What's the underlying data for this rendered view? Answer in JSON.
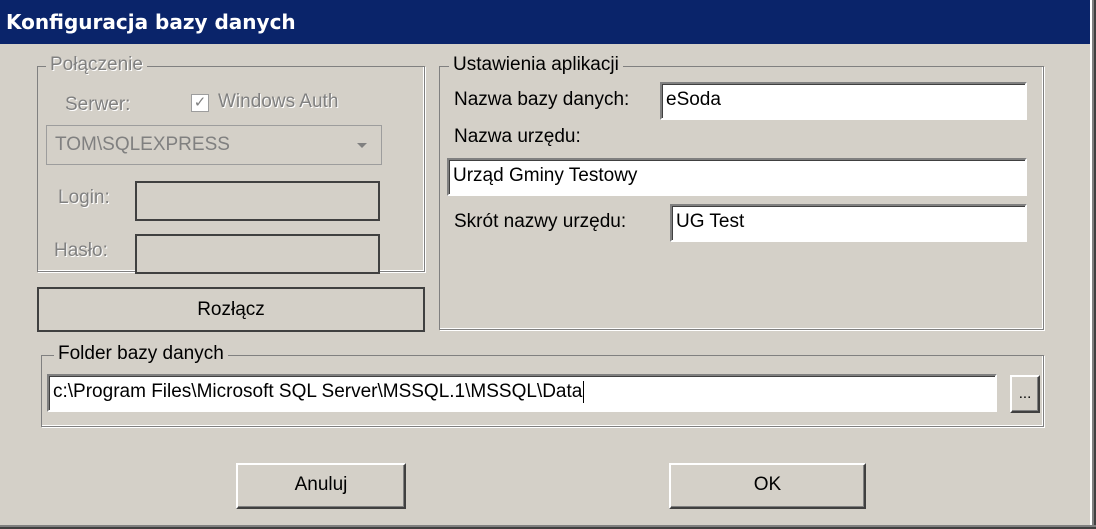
{
  "window": {
    "title": "Konfiguracja bazy danych"
  },
  "connection": {
    "legend": "Połączenie",
    "server_label": "Serwer:",
    "windows_auth_label": "Windows Auth",
    "windows_auth_checked": true,
    "server_value": "TOM\\SQLEXPRESS",
    "login_label": "Login:",
    "login_value": "",
    "password_label": "Hasło:",
    "password_value": "",
    "disconnect_label": "Rozłącz"
  },
  "app_settings": {
    "legend": "Ustawienia aplikacji",
    "db_name_label": "Nazwa bazy danych:",
    "db_name_value": "eSoda",
    "office_name_label": "Nazwa urzędu:",
    "office_name_value": "Urząd Gminy Testowy",
    "office_short_label": "Skrót nazwy urzędu:",
    "office_short_value": "UG Test"
  },
  "db_folder": {
    "legend": "Folder bazy danych",
    "path_value": "c:\\Program Files\\Microsoft SQL Server\\MSSQL.1\\MSSQL\\Data",
    "browse_label": "..."
  },
  "actions": {
    "cancel_label": "Anuluj",
    "ok_label": "OK"
  }
}
